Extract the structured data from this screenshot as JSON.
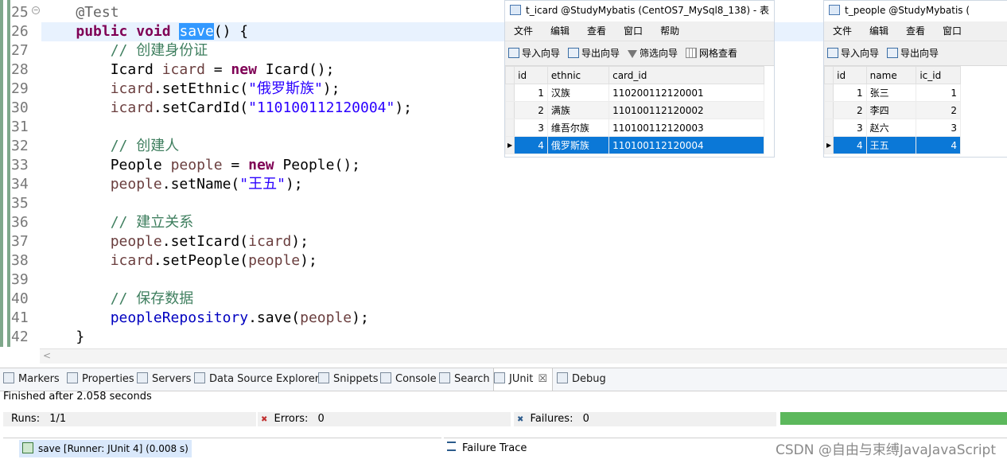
{
  "editor": {
    "lines": [
      {
        "num": "25",
        "parts": [
          {
            "t": "    "
          },
          {
            "t": "@Test",
            "c": "ann"
          }
        ]
      },
      {
        "num": "26",
        "parts": [
          {
            "t": "    "
          },
          {
            "t": "public",
            "c": "kw"
          },
          {
            "t": " "
          },
          {
            "t": "void",
            "c": "kw"
          },
          {
            "t": " "
          },
          {
            "t": "save",
            "c": "sel"
          },
          {
            "t": "() {"
          }
        ]
      },
      {
        "num": "27",
        "parts": [
          {
            "t": "        "
          },
          {
            "t": "// 创建身份证",
            "c": "cmt"
          }
        ]
      },
      {
        "num": "28",
        "parts": [
          {
            "t": "        Icard "
          },
          {
            "t": "icard",
            "c": "var"
          },
          {
            "t": " = "
          },
          {
            "t": "new",
            "c": "kw"
          },
          {
            "t": " Icard();"
          }
        ]
      },
      {
        "num": "29",
        "parts": [
          {
            "t": "        "
          },
          {
            "t": "icard",
            "c": "var"
          },
          {
            "t": ".setEthnic("
          },
          {
            "t": "\"俄罗斯族\"",
            "c": "str"
          },
          {
            "t": ");"
          }
        ]
      },
      {
        "num": "30",
        "parts": [
          {
            "t": "        "
          },
          {
            "t": "icard",
            "c": "var"
          },
          {
            "t": ".setCardId("
          },
          {
            "t": "\"110100112120004\"",
            "c": "str"
          },
          {
            "t": ");"
          }
        ]
      },
      {
        "num": "31",
        "parts": []
      },
      {
        "num": "32",
        "parts": [
          {
            "t": "        "
          },
          {
            "t": "// 创建人",
            "c": "cmt"
          }
        ]
      },
      {
        "num": "33",
        "parts": [
          {
            "t": "        People "
          },
          {
            "t": "people",
            "c": "var"
          },
          {
            "t": " = "
          },
          {
            "t": "new",
            "c": "kw"
          },
          {
            "t": " People();"
          }
        ]
      },
      {
        "num": "34",
        "parts": [
          {
            "t": "        "
          },
          {
            "t": "people",
            "c": "var"
          },
          {
            "t": ".setName("
          },
          {
            "t": "\"王五\"",
            "c": "str"
          },
          {
            "t": ");"
          }
        ]
      },
      {
        "num": "35",
        "parts": []
      },
      {
        "num": "36",
        "parts": [
          {
            "t": "        "
          },
          {
            "t": "// 建立关系",
            "c": "cmt"
          }
        ]
      },
      {
        "num": "37",
        "parts": [
          {
            "t": "        "
          },
          {
            "t": "people",
            "c": "var"
          },
          {
            "t": ".setIcard("
          },
          {
            "t": "icard",
            "c": "var"
          },
          {
            "t": ");"
          }
        ]
      },
      {
        "num": "38",
        "parts": [
          {
            "t": "        "
          },
          {
            "t": "icard",
            "c": "var"
          },
          {
            "t": ".setPeople("
          },
          {
            "t": "people",
            "c": "var"
          },
          {
            "t": ");"
          }
        ]
      },
      {
        "num": "39",
        "parts": []
      },
      {
        "num": "40",
        "parts": [
          {
            "t": "        "
          },
          {
            "t": "// 保存数据",
            "c": "cmt"
          }
        ]
      },
      {
        "num": "41",
        "parts": [
          {
            "t": "        "
          },
          {
            "t": "peopleRepository",
            "c": "fld"
          },
          {
            "t": ".save("
          },
          {
            "t": "people",
            "c": "var"
          },
          {
            "t": ");"
          }
        ]
      },
      {
        "num": "42",
        "parts": [
          {
            "t": "    }"
          }
        ]
      }
    ],
    "scroll_arrow": "<"
  },
  "icard_window": {
    "title": "t_icard @StudyMybatis (CentOS7_MySql8_138) - 表",
    "menu": [
      "文件",
      "编辑",
      "查看",
      "窗口",
      "帮助"
    ],
    "toolbar": [
      "导入向导",
      "导出向导",
      "筛选向导",
      "网格查看"
    ],
    "columns": [
      "id",
      "ethnic",
      "card_id"
    ],
    "rows": [
      [
        "1",
        "汉族",
        "110200112120001"
      ],
      [
        "2",
        "满族",
        "110100112120002"
      ],
      [
        "3",
        "维吾尔族",
        "110100112120003"
      ],
      [
        "4",
        "俄罗斯族",
        "110100112120004"
      ]
    ],
    "selected_row_index": 3,
    "row_pointer": "▶"
  },
  "people_window": {
    "title": "t_people @StudyMybatis (",
    "menu": [
      "文件",
      "编辑",
      "查看",
      "窗口"
    ],
    "toolbar": [
      "导入向导",
      "导出向导"
    ],
    "columns": [
      "id",
      "name",
      "ic_id"
    ],
    "rows": [
      [
        "1",
        "张三",
        "1"
      ],
      [
        "2",
        "李四",
        "2"
      ],
      [
        "3",
        "赵六",
        "3"
      ],
      [
        "4",
        "王五",
        "4"
      ]
    ],
    "selected_row_index": 3,
    "row_pointer": "▶"
  },
  "bottom_tabs": [
    {
      "label": "Markers",
      "icon": "markers-icon"
    },
    {
      "label": "Properties",
      "icon": "properties-icon"
    },
    {
      "label": "Servers",
      "icon": "servers-icon"
    },
    {
      "label": "Data Source Explorer",
      "icon": "data-source-explorer-icon"
    },
    {
      "label": "Snippets",
      "icon": "snippets-icon"
    },
    {
      "label": "Console",
      "icon": "console-icon"
    },
    {
      "label": "Search",
      "icon": "search-icon"
    },
    {
      "label": "JUnit",
      "icon": "junit-icon",
      "active": true,
      "close": "☒"
    },
    {
      "label": "Debug",
      "icon": "debug-icon"
    }
  ],
  "junit": {
    "status": "Finished after 2.058 seconds",
    "runs_label": "Runs:",
    "runs_value": "1/1",
    "errors_label": "Errors:",
    "errors_value": "0",
    "failures_label": "Failures:",
    "failures_value": "0",
    "progress_fraction": 1.0,
    "progress_color": "#5cb85c",
    "tree_item": "save [Runner: JUnit 4] (0.008 s)",
    "failure_trace_label": "Failure Trace"
  },
  "watermark": "CSDN @自由与束缚JavaJavaScript"
}
